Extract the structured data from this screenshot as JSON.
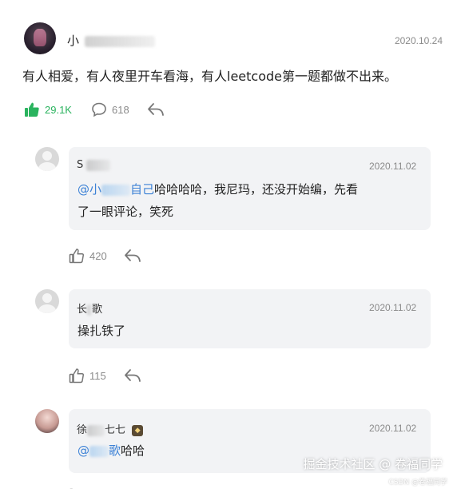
{
  "main_comment": {
    "author": "小",
    "date": "2020.10.24",
    "text": "有人相爱，有人夜里开车看海，有人leetcode第一题都做不出来。",
    "likes": "29.1K",
    "comments": "618"
  },
  "replies": [
    {
      "author": "S",
      "date": "2020.11.02",
      "mention_prefix": "@小",
      "mention_suffix": "自己",
      "text_line1": "哈哈哈哈，我尼玛，还没开始编，先看",
      "text_line2": "了一眼评论，笑死",
      "likes": "420"
    },
    {
      "author": "长",
      "author_suffix": "歌",
      "date": "2020.11.02",
      "text": "操扎铁了",
      "likes": "115"
    },
    {
      "author": "徐",
      "author_suffix": "七七",
      "date": "2020.11.02",
      "mention_prefix": "@",
      "mention_suffix": "歌",
      "text": "哈哈"
    }
  ],
  "watermark": {
    "line1": "掘金技术社区 @ 卷福同学",
    "line2": "CSDN @卷福同学"
  },
  "colors": {
    "like_active": "#2ab35e",
    "mention": "#3d82d6",
    "bubble": "#f2f3f5",
    "meta": "#8a8a8a"
  }
}
